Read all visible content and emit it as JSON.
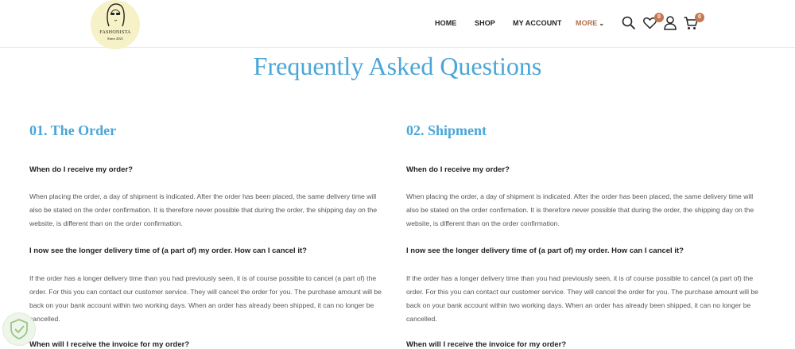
{
  "header": {
    "logo_name": "FASHONISTA",
    "logo_since": "Since 2021",
    "nav": [
      "HOME",
      "SHOP",
      "MY ACCOUNT",
      "MORE"
    ],
    "wishlist_count": "0",
    "cart_count": "0"
  },
  "page_title": "Frequently Asked Questions",
  "sections": [
    {
      "title": "01. The Order",
      "q1": "When do I receive my order?",
      "a1": "When placing the order, a day of shipment is indicated. After the order has been placed, the same delivery time will also be stated on the order confirmation. It is therefore never possible that during the order, the shipping day on the website, is different than on the order confirmation.",
      "q2": "I now see the longer delivery time of (a part of) my order. How can I cancel it?",
      "a2": "If the order has a longer delivery time than you had previously seen, it is of course possible to cancel (a part of) the order. For this you can contact our customer service. They will cancel the order for you. The purchase amount will be back on your bank account within two working days. When an order has already been shipped, it can no longer be cancelled.",
      "q3": "When will I receive the invoice for my order?"
    },
    {
      "title": "02. Shipment",
      "q1": "When do I receive my order?",
      "a1": "When placing the order, a day of shipment is indicated. After the order has been placed, the same delivery time will also be stated on the order confirmation. It is therefore never possible that during the order, the shipping day on the website, is different than on the order confirmation.",
      "q2": "I now see the longer delivery time of (a part of) my order. How can I cancel it?",
      "a2": "If the order has a longer delivery time than you had previously seen, it is of course possible to cancel (a part of) the order. For this you can contact our customer service. They will cancel the order for you. The purchase amount will be back on your bank account within two working days. When an order has already been shipped, it can no longer be cancelled.",
      "q3": "When will I receive the invoice for my order?"
    }
  ],
  "colors": {
    "accent": "#4aa6d8",
    "badge": "#c47850",
    "more": "#b0704a"
  }
}
